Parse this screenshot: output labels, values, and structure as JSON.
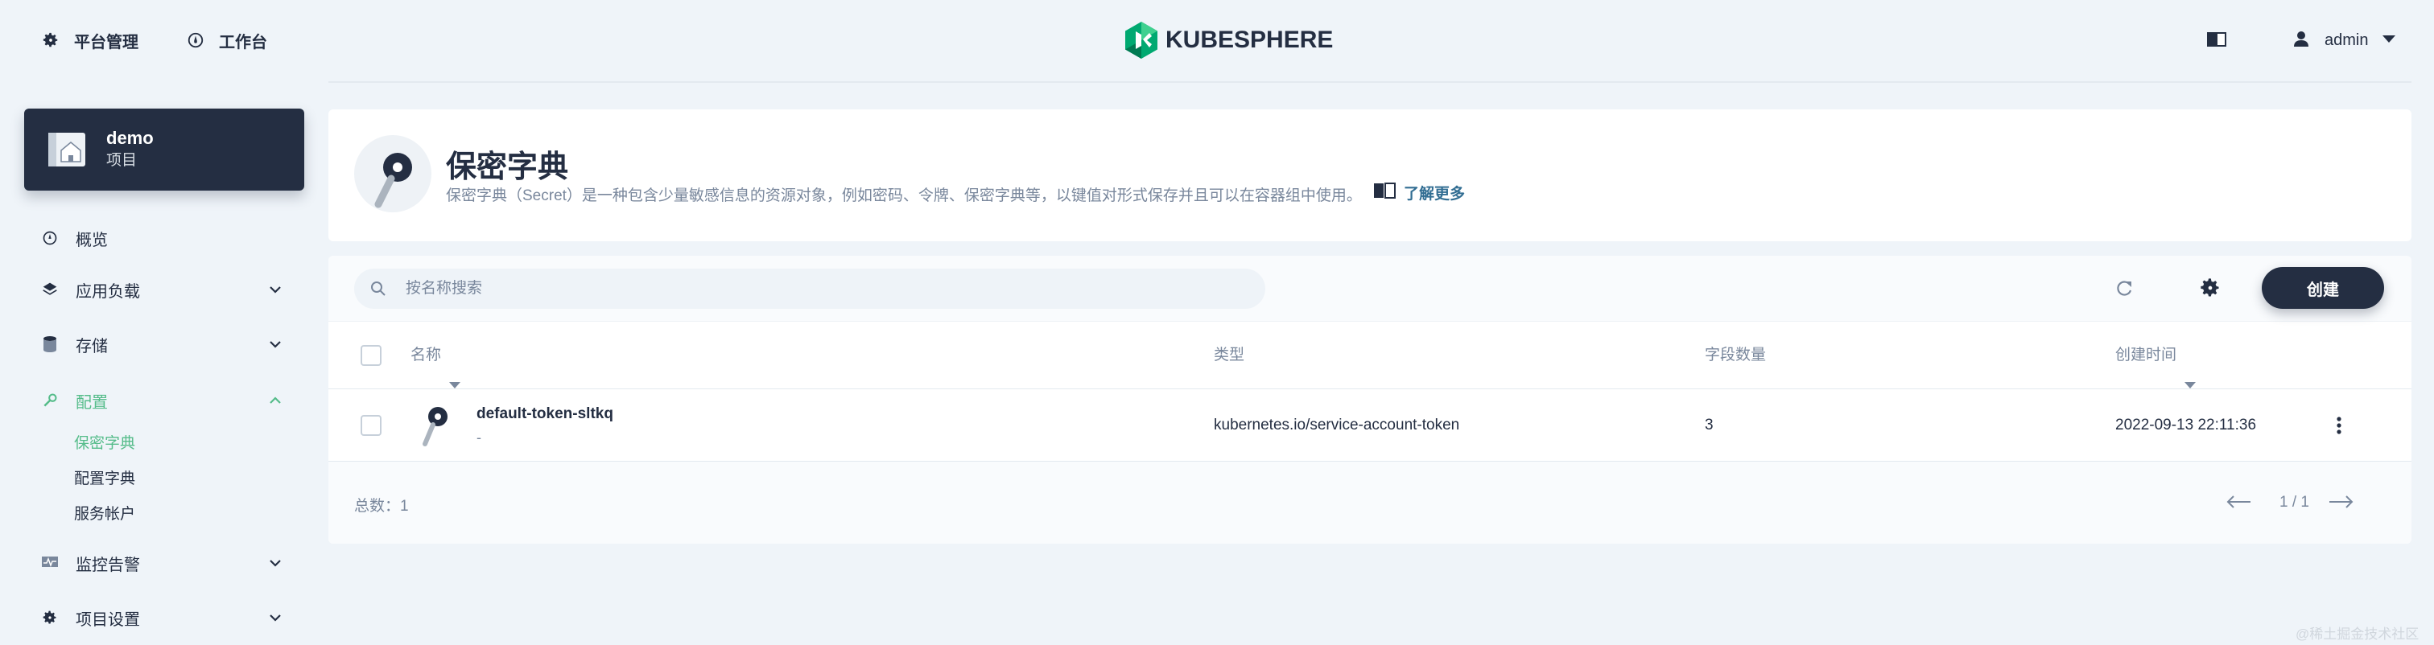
{
  "header": {
    "nav": [
      {
        "label": "平台管理",
        "icon": "gear-icon"
      },
      {
        "label": "工作台",
        "icon": "compass-icon"
      }
    ],
    "brand": "KUBESPHERE",
    "user": "admin"
  },
  "sidebar": {
    "project": {
      "name": "demo",
      "type": "项目"
    },
    "items": [
      {
        "label": "概览"
      },
      {
        "label": "应用负载"
      },
      {
        "label": "存储"
      },
      {
        "label": "配置"
      },
      {
        "label": "监控告警"
      },
      {
        "label": "项目设置"
      }
    ],
    "config_sub": [
      "保密字典",
      "配置字典",
      "服务帐户"
    ]
  },
  "banner": {
    "title": "保密字典",
    "description": "保密字典（Secret）是一种包含少量敏感信息的资源对象，例如密码、令牌、保密字典等，以键值对形式保存并且可以在容器组中使用。",
    "learn_more": "了解更多"
  },
  "toolbar": {
    "search_placeholder": "按名称搜索",
    "create_label": "创建"
  },
  "table": {
    "columns": [
      "名称",
      "类型",
      "字段数量",
      "创建时间"
    ],
    "rows": [
      {
        "name": "default-token-sltkq",
        "description": "-",
        "type": "kubernetes.io/service-account-token",
        "fields": "3",
        "created": "2022-09-13 22:11:36"
      }
    ],
    "total_label": "总数：",
    "total": "1",
    "page": "1 / 1"
  },
  "watermark": "@稀土掘金技术社区",
  "colors": {
    "accent": "#55bc8a",
    "dark": "#242e42",
    "muted": "#79879c",
    "background": "#eff4f9"
  }
}
